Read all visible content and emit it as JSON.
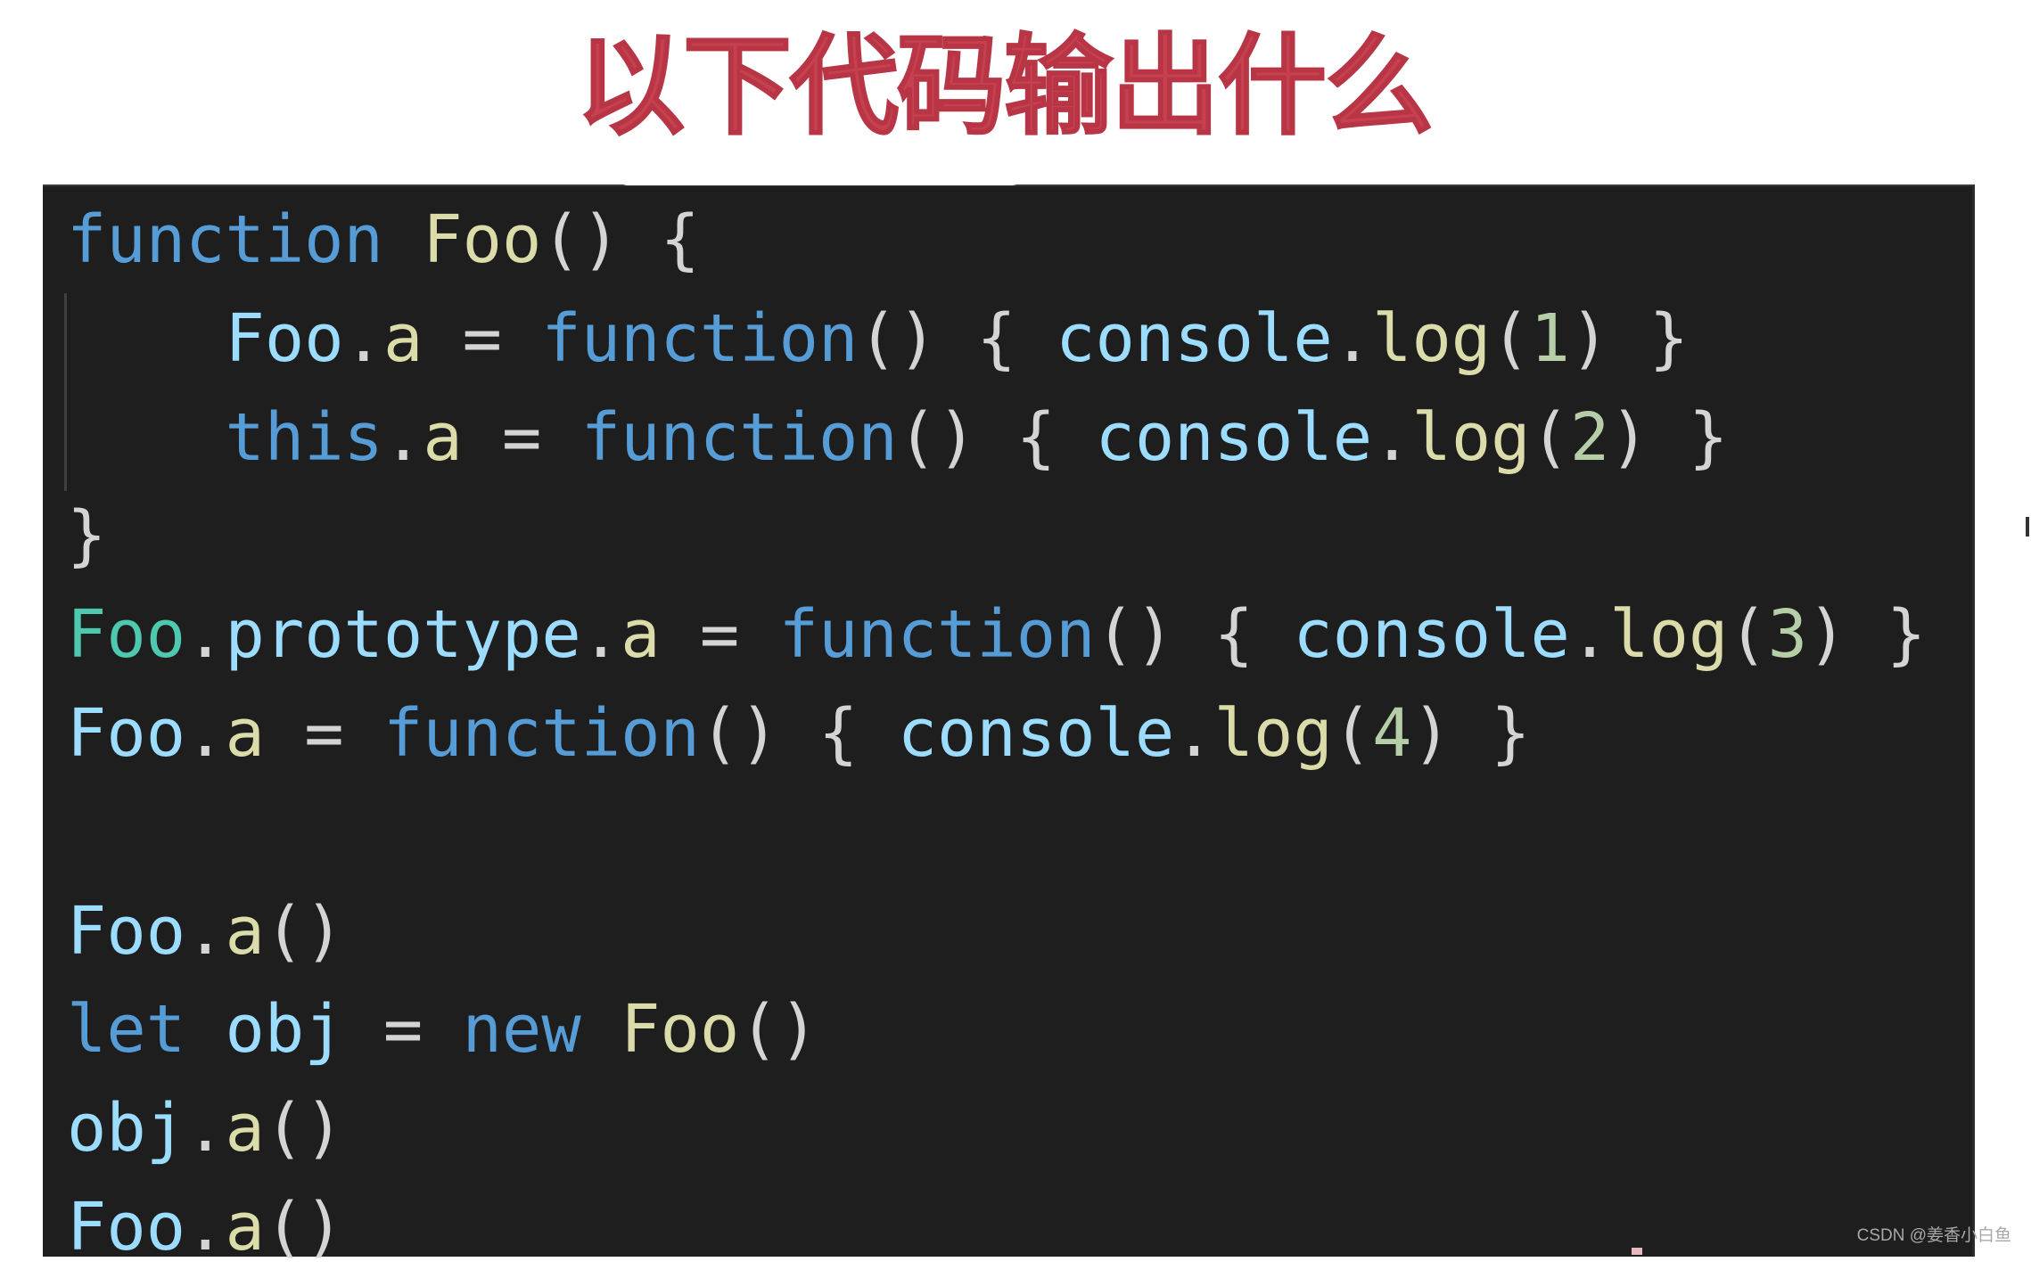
{
  "title": "以下代码输出什么",
  "colors": {
    "title": "#c6404f",
    "editor_background": "#1e1e1e",
    "keyword": "#569cd6",
    "function_name": "#dcdcaa",
    "variable": "#9cdcfe",
    "class": "#4ec9b0",
    "number": "#b5cea8",
    "punctuation": "#d4d4d4"
  },
  "code": {
    "language": "javascript",
    "lines": [
      [
        {
          "t": "function",
          "c": "kw"
        },
        {
          "t": " ",
          "c": "punc"
        },
        {
          "t": "Foo",
          "c": "fn"
        },
        {
          "t": "() {",
          "c": "punc"
        }
      ],
      [
        {
          "t": "    ",
          "c": "punc"
        },
        {
          "t": "Foo",
          "c": "var"
        },
        {
          "t": ".",
          "c": "punc"
        },
        {
          "t": "a",
          "c": "fn"
        },
        {
          "t": " = ",
          "c": "punc"
        },
        {
          "t": "function",
          "c": "kw"
        },
        {
          "t": "() { ",
          "c": "punc"
        },
        {
          "t": "console",
          "c": "var"
        },
        {
          "t": ".",
          "c": "punc"
        },
        {
          "t": "log",
          "c": "fn"
        },
        {
          "t": "(",
          "c": "punc"
        },
        {
          "t": "1",
          "c": "num"
        },
        {
          "t": ") }",
          "c": "punc"
        }
      ],
      [
        {
          "t": "    ",
          "c": "punc"
        },
        {
          "t": "this",
          "c": "kw"
        },
        {
          "t": ".",
          "c": "punc"
        },
        {
          "t": "a",
          "c": "fn"
        },
        {
          "t": " = ",
          "c": "punc"
        },
        {
          "t": "function",
          "c": "kw"
        },
        {
          "t": "() { ",
          "c": "punc"
        },
        {
          "t": "console",
          "c": "var"
        },
        {
          "t": ".",
          "c": "punc"
        },
        {
          "t": "log",
          "c": "fn"
        },
        {
          "t": "(",
          "c": "punc"
        },
        {
          "t": "2",
          "c": "num"
        },
        {
          "t": ") }",
          "c": "punc"
        }
      ],
      [
        {
          "t": "}",
          "c": "punc"
        }
      ],
      [
        {
          "t": "Foo",
          "c": "cls"
        },
        {
          "t": ".",
          "c": "punc"
        },
        {
          "t": "prototype",
          "c": "var"
        },
        {
          "t": ".",
          "c": "punc"
        },
        {
          "t": "a",
          "c": "fn"
        },
        {
          "t": " = ",
          "c": "punc"
        },
        {
          "t": "function",
          "c": "kw"
        },
        {
          "t": "() { ",
          "c": "punc"
        },
        {
          "t": "console",
          "c": "var"
        },
        {
          "t": ".",
          "c": "punc"
        },
        {
          "t": "log",
          "c": "fn"
        },
        {
          "t": "(",
          "c": "punc"
        },
        {
          "t": "3",
          "c": "num"
        },
        {
          "t": ") }",
          "c": "punc"
        }
      ],
      [
        {
          "t": "Foo",
          "c": "var"
        },
        {
          "t": ".",
          "c": "punc"
        },
        {
          "t": "a",
          "c": "fn"
        },
        {
          "t": " = ",
          "c": "punc"
        },
        {
          "t": "function",
          "c": "kw"
        },
        {
          "t": "() { ",
          "c": "punc"
        },
        {
          "t": "console",
          "c": "var"
        },
        {
          "t": ".",
          "c": "punc"
        },
        {
          "t": "log",
          "c": "fn"
        },
        {
          "t": "(",
          "c": "punc"
        },
        {
          "t": "4",
          "c": "num"
        },
        {
          "t": ") }",
          "c": "punc"
        }
      ],
      [],
      [
        {
          "t": "Foo",
          "c": "var"
        },
        {
          "t": ".",
          "c": "punc"
        },
        {
          "t": "a",
          "c": "fn"
        },
        {
          "t": "()",
          "c": "punc"
        }
      ],
      [
        {
          "t": "let",
          "c": "kw"
        },
        {
          "t": " ",
          "c": "punc"
        },
        {
          "t": "obj",
          "c": "var"
        },
        {
          "t": " = ",
          "c": "punc"
        },
        {
          "t": "new",
          "c": "kw"
        },
        {
          "t": " ",
          "c": "punc"
        },
        {
          "t": "Foo",
          "c": "fn"
        },
        {
          "t": "()",
          "c": "punc"
        }
      ],
      [
        {
          "t": "obj",
          "c": "var"
        },
        {
          "t": ".",
          "c": "punc"
        },
        {
          "t": "a",
          "c": "fn"
        },
        {
          "t": "()",
          "c": "punc"
        }
      ],
      [
        {
          "t": "Foo",
          "c": "var"
        },
        {
          "t": ".",
          "c": "punc"
        },
        {
          "t": "a",
          "c": "fn"
        },
        {
          "t": "()",
          "c": "punc"
        }
      ]
    ]
  },
  "watermark": "CSDN @姜香小白鱼"
}
